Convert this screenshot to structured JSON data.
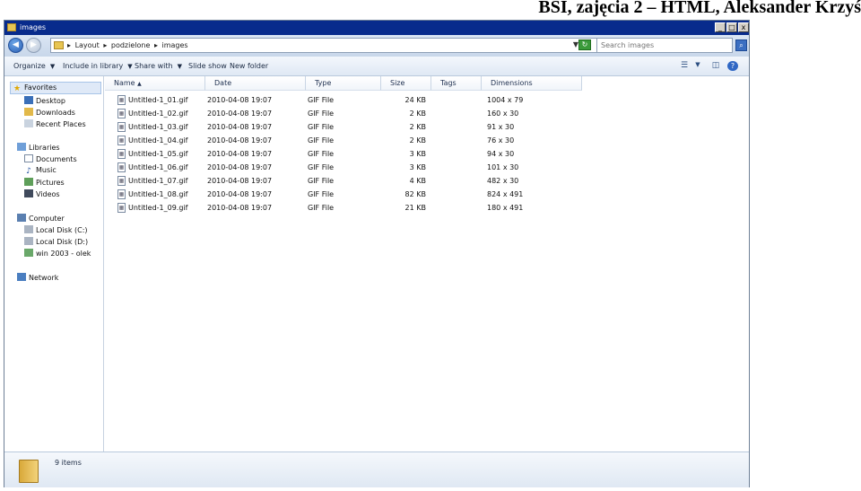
{
  "slide": {
    "header": "BSI, zajęcia 2 – HTML, Aleksander Krzyś"
  },
  "window": {
    "title": "images",
    "controls": {
      "minimize": "_",
      "maximize": "□",
      "close": "x"
    }
  },
  "address": {
    "crumbs": [
      "Layout",
      "podzielone",
      "images"
    ],
    "separator": "▸",
    "search_placeholder": "Search images"
  },
  "toolbar": {
    "organize": "Organize",
    "include_in_library": "Include in library",
    "share_with": "Share with",
    "slide_show": "Slide show",
    "new_folder": "New folder"
  },
  "nav": {
    "favorites": "Favorites",
    "desktop": "Desktop",
    "downloads": "Downloads",
    "recent_places": "Recent Places",
    "libraries": "Libraries",
    "documents": "Documents",
    "music": "Music",
    "pictures": "Pictures",
    "videos": "Videos",
    "computer": "Computer",
    "local_c": "Local Disk (C:)",
    "local_d": "Local Disk (D:)",
    "win2003": "win 2003 - olek",
    "network": "Network"
  },
  "columns": {
    "name": "Name",
    "date": "Date",
    "type": "Type",
    "size": "Size",
    "tags": "Tags",
    "dimensions": "Dimensions"
  },
  "files": [
    {
      "name": "Untitled-1_01.gif",
      "date": "2010-04-08 19:07",
      "type": "GIF File",
      "size": "24 KB",
      "dimensions": "1004 x 79"
    },
    {
      "name": "Untitled-1_02.gif",
      "date": "2010-04-08 19:07",
      "type": "GIF File",
      "size": "2 KB",
      "dimensions": "160 x 30"
    },
    {
      "name": "Untitled-1_03.gif",
      "date": "2010-04-08 19:07",
      "type": "GIF File",
      "size": "2 KB",
      "dimensions": "91 x 30"
    },
    {
      "name": "Untitled-1_04.gif",
      "date": "2010-04-08 19:07",
      "type": "GIF File",
      "size": "2 KB",
      "dimensions": "76 x 30"
    },
    {
      "name": "Untitled-1_05.gif",
      "date": "2010-04-08 19:07",
      "type": "GIF File",
      "size": "3 KB",
      "dimensions": "94 x 30"
    },
    {
      "name": "Untitled-1_06.gif",
      "date": "2010-04-08 19:07",
      "type": "GIF File",
      "size": "3 KB",
      "dimensions": "101 x 30"
    },
    {
      "name": "Untitled-1_07.gif",
      "date": "2010-04-08 19:07",
      "type": "GIF File",
      "size": "4 KB",
      "dimensions": "482 x 30"
    },
    {
      "name": "Untitled-1_08.gif",
      "date": "2010-04-08 19:07",
      "type": "GIF File",
      "size": "82 KB",
      "dimensions": "824 x 491"
    },
    {
      "name": "Untitled-1_09.gif",
      "date": "2010-04-08 19:07",
      "type": "GIF File",
      "size": "21 KB",
      "dimensions": "180 x 491"
    }
  ],
  "details": {
    "item_count": "9 items"
  }
}
